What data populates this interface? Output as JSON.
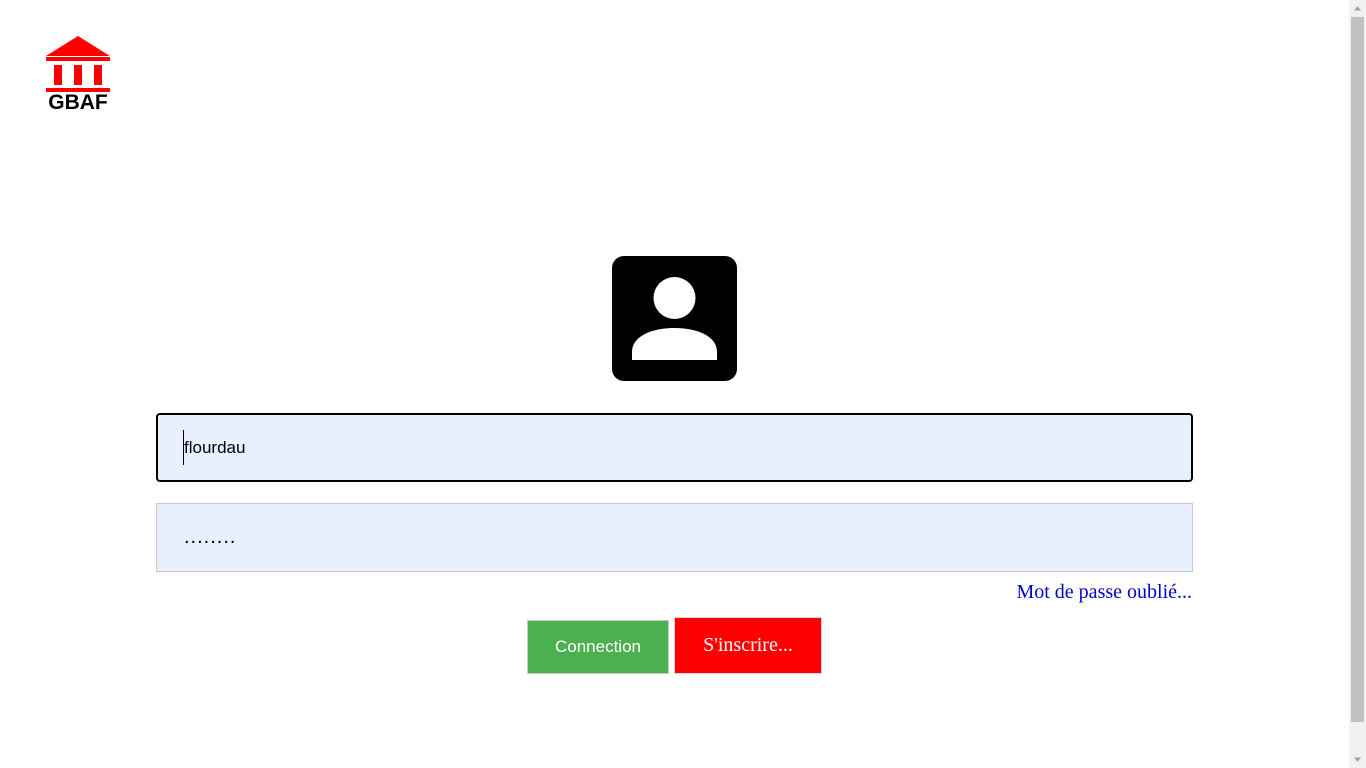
{
  "logo": {
    "text": "GBAF",
    "brand_color": "#ff0000",
    "icon": "bank-building-icon"
  },
  "avatar": {
    "icon": "user-profile-icon"
  },
  "login_form": {
    "username_value": "flourdau",
    "password_value": "........",
    "forgot_password_label": "Mot de passe oublié...",
    "connect_label": "Connection",
    "signup_label": "S'inscrire..."
  },
  "colors": {
    "input_background": "#e8f0fe",
    "connect_button": "#4caf50",
    "signup_button": "#ff0000",
    "link": "#0000c8"
  }
}
